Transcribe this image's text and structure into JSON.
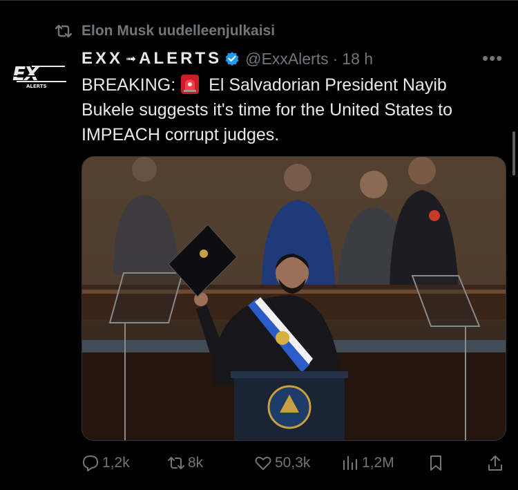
{
  "repost": {
    "text": "Elon Musk uudelleenjulkaisi",
    "icon": "repost-icon"
  },
  "author": {
    "brand_left": "EXX",
    "brand_arrow": "➟",
    "brand_right": "ALERTS",
    "handle": "@ExxAlerts",
    "time_separator": "·",
    "time": "18 h",
    "verified_color": "#1d9bf0",
    "avatar_text": "EX",
    "avatar_subtext": "ALERTS"
  },
  "tweet": {
    "text_before": "BREAKING:",
    "emoji": "siren-icon",
    "text_after": "El Salvadorian President Nayib Bukele suggests it's time for the United States to IMPEACH corrupt judges."
  },
  "media": {
    "alt": "photo",
    "podium_seal": "seal-icon"
  },
  "actions": {
    "replies": "1,2k",
    "reposts": "8k",
    "likes": "50,3k",
    "views": "1,2M"
  },
  "more_label": "•••"
}
